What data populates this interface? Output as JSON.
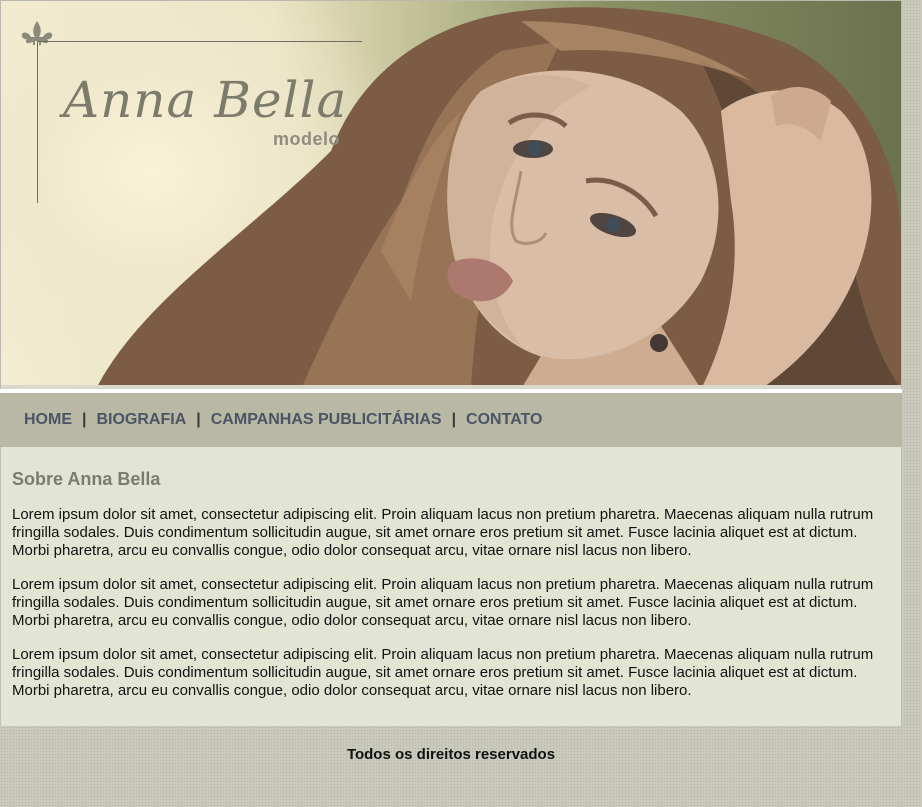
{
  "header": {
    "logo_name": "Anna Bella",
    "logo_subtitle": "modelo"
  },
  "nav": {
    "items": [
      {
        "label": "HOME"
      },
      {
        "label": "BIOGRAFIA"
      },
      {
        "label": "CAMPANHAS PUBLICITÁRIAS"
      },
      {
        "label": "CONTATO"
      }
    ],
    "separator": "|"
  },
  "content": {
    "title": "Sobre Anna Bella",
    "paragraphs": [
      "Lorem ipsum dolor sit amet, consectetur adipiscing elit. Proin aliquam lacus non pretium pharetra. Maecenas aliquam nulla rutrum fringilla sodales. Duis condimentum sollicitudin augue, sit amet ornare eros pretium sit amet. Fusce lacinia aliquet est at dictum. Morbi pharetra, arcu eu convallis congue, odio dolor consequat arcu, vitae ornare nisl lacus non libero.",
      "Lorem ipsum dolor sit amet, consectetur adipiscing elit. Proin aliquam lacus non pretium pharetra. Maecenas aliquam nulla rutrum fringilla sodales. Duis condimentum sollicitudin augue, sit amet ornare eros pretium sit amet. Fusce lacinia aliquet est at dictum. Morbi pharetra, arcu eu convallis congue, odio dolor consequat arcu, vitae ornare nisl lacus non libero.",
      "Lorem ipsum dolor sit amet, consectetur adipiscing elit. Proin aliquam lacus non pretium pharetra. Maecenas aliquam nulla rutrum fringilla sodales. Duis condimentum sollicitudin augue, sit amet ornare eros pretium sit amet. Fusce lacinia aliquet est at dictum. Morbi pharetra, arcu eu convallis congue, odio dolor consequat arcu, vitae ornare nisl lacus non libero."
    ]
  },
  "footer": {
    "text": "Todos os direitos reservados"
  },
  "colors": {
    "nav_background": "#b8b8a5",
    "nav_link": "#4b5566",
    "content_background": "#e3e5d4",
    "title": "#7b7b70",
    "logo": "#7c7b6c"
  },
  "icons": {
    "logo_ornament": "fleur-de-lis-icon"
  }
}
